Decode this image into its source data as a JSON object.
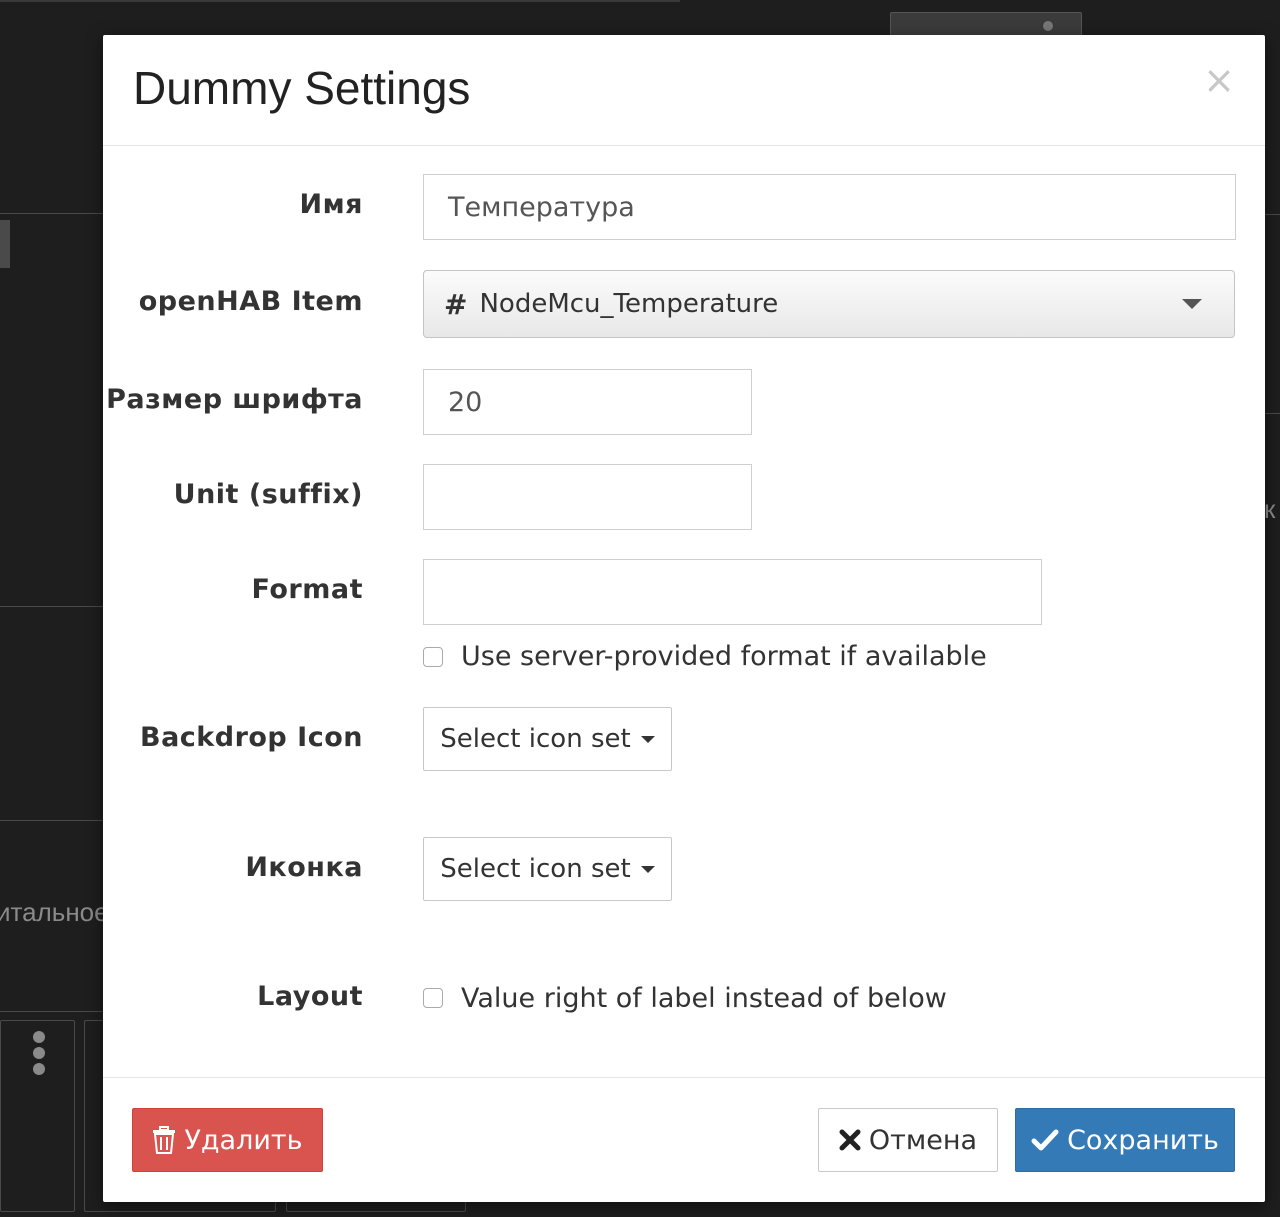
{
  "background": {
    "partial_text_left": "итальное",
    "partial_text_right": "к"
  },
  "modal": {
    "title": "Dummy Settings",
    "close_glyph": "×",
    "fields": {
      "name_label": "Имя",
      "name_value": "Температура",
      "item_label": "openHAB Item",
      "item_hash": "#",
      "item_value": "NodeMcu_Temperature",
      "font_size_label": "Размер шрифта",
      "font_size_value": "20",
      "unit_label": "Unit (suffix)",
      "unit_value": "",
      "format_label": "Format",
      "format_value": "",
      "format_checkbox_label": "Use server-provided format if available",
      "backdrop_label": "Backdrop Icon",
      "backdrop_button": "Select icon set",
      "icon_label": "Иконка",
      "icon_button": "Select icon set",
      "layout_label": "Layout",
      "layout_checkbox_label": "Value right of label instead of below"
    },
    "footer": {
      "delete_label": "Удалить",
      "cancel_label": "Отмена",
      "save_label": "Сохранить"
    }
  },
  "colors": {
    "danger": "#d9534f",
    "primary": "#337ab7",
    "backdrop": "#1e1e1e"
  },
  "icons": {
    "close": "close-icon",
    "delete": "trash-icon",
    "cancel": "x-icon",
    "save": "check-icon",
    "select": "chevron-down-icon"
  }
}
